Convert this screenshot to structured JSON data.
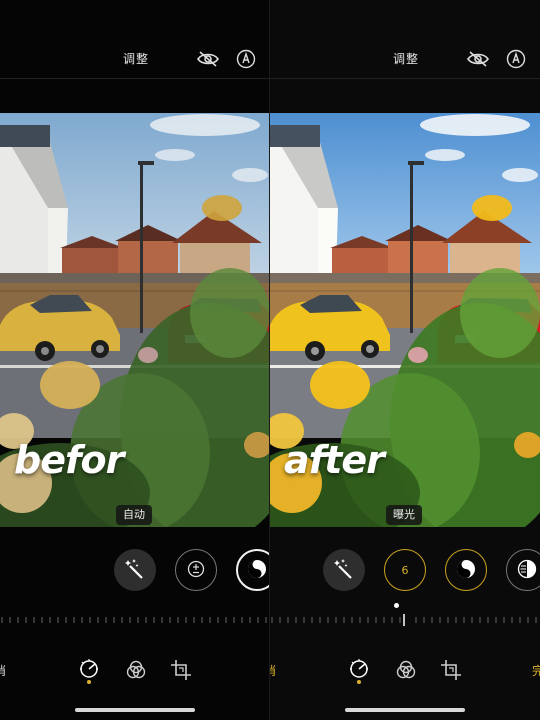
{
  "before": {
    "header_title": "调整",
    "overlay_word": "befor",
    "adjust_pill": "自动",
    "cancel_partial": "消",
    "tools": [
      "wand-icon",
      "exposure-icon",
      "contrast-icon"
    ]
  },
  "after": {
    "header_title": "调整",
    "overlay_word": "after",
    "adjust_pill": "曝光",
    "exposure_value": "6",
    "cancel_partial": "消",
    "done_partial": "完",
    "tools": [
      "wand-icon",
      "exposure-icon",
      "brilliance-icon",
      "highlights-icon"
    ]
  },
  "colors": {
    "accent_gold": "#d9b12a",
    "background": "#000000"
  }
}
